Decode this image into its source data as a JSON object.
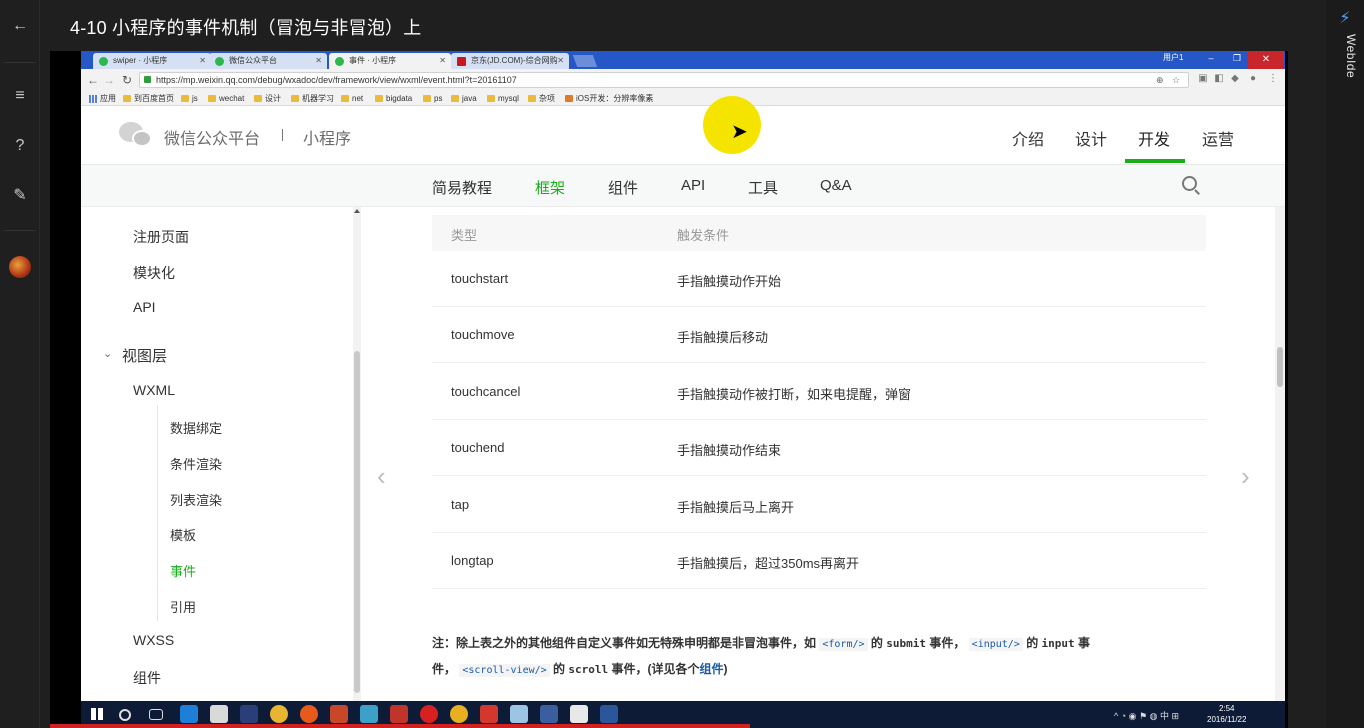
{
  "course": {
    "title": "4-10 小程序的事件机制（冒泡与非冒泡）上"
  },
  "left_rail": {
    "icons": [
      "back-arrow-icon",
      "menu-icon",
      "question-icon",
      "edit-icon",
      "avatar"
    ]
  },
  "right_panel": {
    "label": "WebIde"
  },
  "browser": {
    "tabs": [
      {
        "label": "swiper · 小程序",
        "icon": "wechat-icon"
      },
      {
        "label": "微信公众平台",
        "icon": "wechat-icon"
      },
      {
        "label": "事件 · 小程序",
        "icon": "wechat-icon",
        "active": true
      },
      {
        "label": "京东(JD.COM)-综合网购",
        "icon": "jd-icon"
      }
    ],
    "window_user": "用户1",
    "url": "https://mp.weixin.qq.com/debug/wxadoc/dev/framework/view/wxml/event.html?t=20161107",
    "bookmarks": [
      "应用",
      "到百度首页",
      "js",
      "wechat",
      "设计",
      "机器学习",
      "net",
      "bigdata",
      "ps",
      "java",
      "mysql",
      "杂项",
      "iOS开发：分辨率像素"
    ]
  },
  "site": {
    "brand": "微信公众平台",
    "brand_sub": "小程序",
    "topnav": [
      "介绍",
      "设计",
      "开发",
      "运营"
    ],
    "topnav_active": "开发",
    "subnav": [
      "简易教程",
      "框架",
      "组件",
      "API",
      "工具",
      "Q&A"
    ],
    "subnav_active": "框架"
  },
  "sidebar": {
    "items": [
      "注册页面",
      "模块化",
      "API",
      "视图层",
      "WXML",
      "数据绑定",
      "条件渲染",
      "列表渲染",
      "模板",
      "事件",
      "引用",
      "WXSS",
      "组件"
    ],
    "active": "事件"
  },
  "table": {
    "headers": [
      "类型",
      "触发条件"
    ],
    "rows": [
      [
        "touchstart",
        "手指触摸动作开始"
      ],
      [
        "touchmove",
        "手指触摸后移动"
      ],
      [
        "touchcancel",
        "手指触摸动作被打断，如来电提醒，弹窗"
      ],
      [
        "touchend",
        "手指触摸动作结束"
      ],
      [
        "tap",
        "手指触摸后马上离开"
      ],
      [
        "longtap",
        "手指触摸后，超过350ms再离开"
      ]
    ]
  },
  "note": {
    "p1": "注：除上表之外的其他组件自定义事件如无特殊申明都是非冒泡事件，如",
    "code_form": "<form/>",
    "p2": "的",
    "submit": "submit",
    "p3": "事件，",
    "code_input": "<input/>",
    "p4": "的",
    "input": "input",
    "p5": "事",
    "p6": "件，",
    "code_scroll": "<scroll-view/>",
    "p7": "的",
    "scroll": "scroll",
    "p8": "事件，(详见各个",
    "link": "组件",
    "p9": ")"
  },
  "taskbar": {
    "time": "2:54",
    "date": "2016/11/22",
    "ime": "中"
  }
}
